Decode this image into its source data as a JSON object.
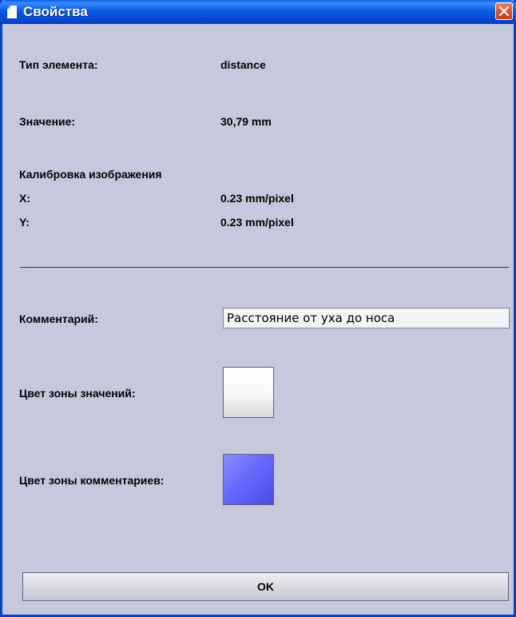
{
  "window": {
    "title": "Свойства",
    "icon": "document-icon",
    "close_icon": "close-icon"
  },
  "properties": {
    "type_label": "Тип элемента:",
    "type_value": "distance",
    "value_label": "Значение:",
    "value_value": "30,79 mm",
    "calibration_heading": "Калибровка изображения",
    "x_label": "X:",
    "x_value": "0.23 mm/pixel",
    "y_label": "Y:",
    "y_value": "0.23 mm/pixel"
  },
  "comment": {
    "label": "Комментарий:",
    "value": "Расстояние от уха до носа"
  },
  "colors": {
    "values_zone_label": "Цвет зоны значений:",
    "values_zone_color": "#ffffff",
    "comments_zone_label": "Цвет зоны комментариев:",
    "comments_zone_color": "#6566fb"
  },
  "footer": {
    "ok_label": "OK"
  },
  "theme": {
    "window_bg": "#c6c9de",
    "titlebar": "#0a5be4",
    "separator": "#1d2a9a"
  }
}
